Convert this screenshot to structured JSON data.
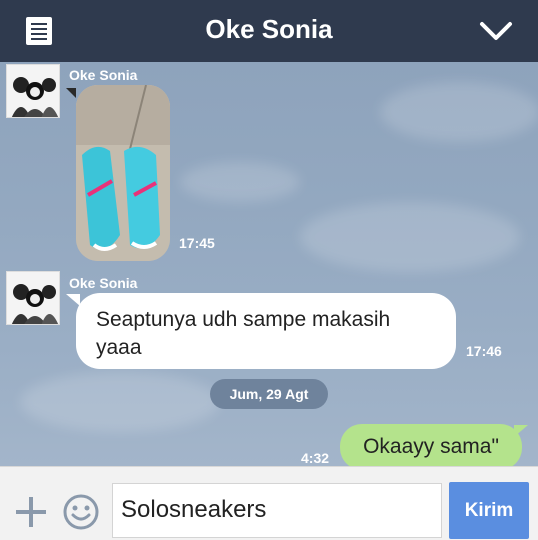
{
  "header": {
    "title": "Oke Sonia",
    "menu_icon": "menu-list-icon",
    "collapse_icon": "chevron-down-icon"
  },
  "messages": [
    {
      "sender": "Oke Sonia",
      "type": "photo",
      "photo_desc": "turquoise sneakers",
      "time": "17:45"
    },
    {
      "sender": "Oke Sonia",
      "type": "text",
      "text": "Seaptunya udh sampe makasih yaaa",
      "time": "17:46"
    },
    {
      "type": "date",
      "text": "Jum, 29 Agt"
    },
    {
      "type": "outgoing",
      "text": "Okaayy sama\"",
      "time": "4:32"
    }
  ],
  "input": {
    "value": "Solosneakers",
    "send_label": "Kirim",
    "plus_icon": "plus-icon",
    "emoji_icon": "smiley-icon"
  },
  "colors": {
    "header_bg": "#2f3a4e",
    "outgoing_bubble": "#b4e38c",
    "send_button": "#5a8ee0"
  }
}
